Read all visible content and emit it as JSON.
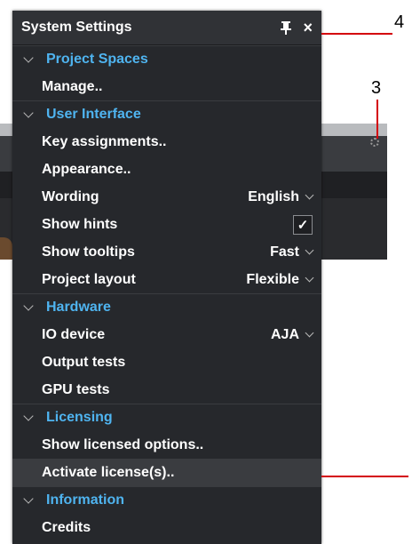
{
  "panel": {
    "title": "System Settings",
    "pin_icon": "pin-icon",
    "close_glyph": "×"
  },
  "sections": {
    "project_spaces": {
      "label": "Project Spaces",
      "items": {
        "manage": "Manage.."
      }
    },
    "user_interface": {
      "label": "User Interface",
      "items": {
        "key_assignments": "Key assignments..",
        "appearance": "Appearance..",
        "wording": {
          "label": "Wording",
          "value": "English"
        },
        "show_hints": {
          "label": "Show hints",
          "checked": true,
          "check_glyph": "✓"
        },
        "show_tooltips": {
          "label": "Show tooltips",
          "value": "Fast"
        },
        "project_layout": {
          "label": "Project layout",
          "value": "Flexible"
        }
      }
    },
    "hardware": {
      "label": "Hardware",
      "items": {
        "io_device": {
          "label": "IO device",
          "value": "AJA"
        },
        "output_tests": "Output tests",
        "gpu_tests": "GPU tests"
      }
    },
    "licensing": {
      "label": "Licensing",
      "items": {
        "show_licensed_options": "Show licensed options..",
        "activate_licenses": "Activate license(s).."
      }
    },
    "information": {
      "label": "Information",
      "items": {
        "credits": "Credits"
      }
    }
  },
  "callouts": {
    "four": "4",
    "three": "3"
  },
  "colors": {
    "accent": "#4fb4f0",
    "panel_bg": "#26282c",
    "callout": "#d4000a"
  }
}
